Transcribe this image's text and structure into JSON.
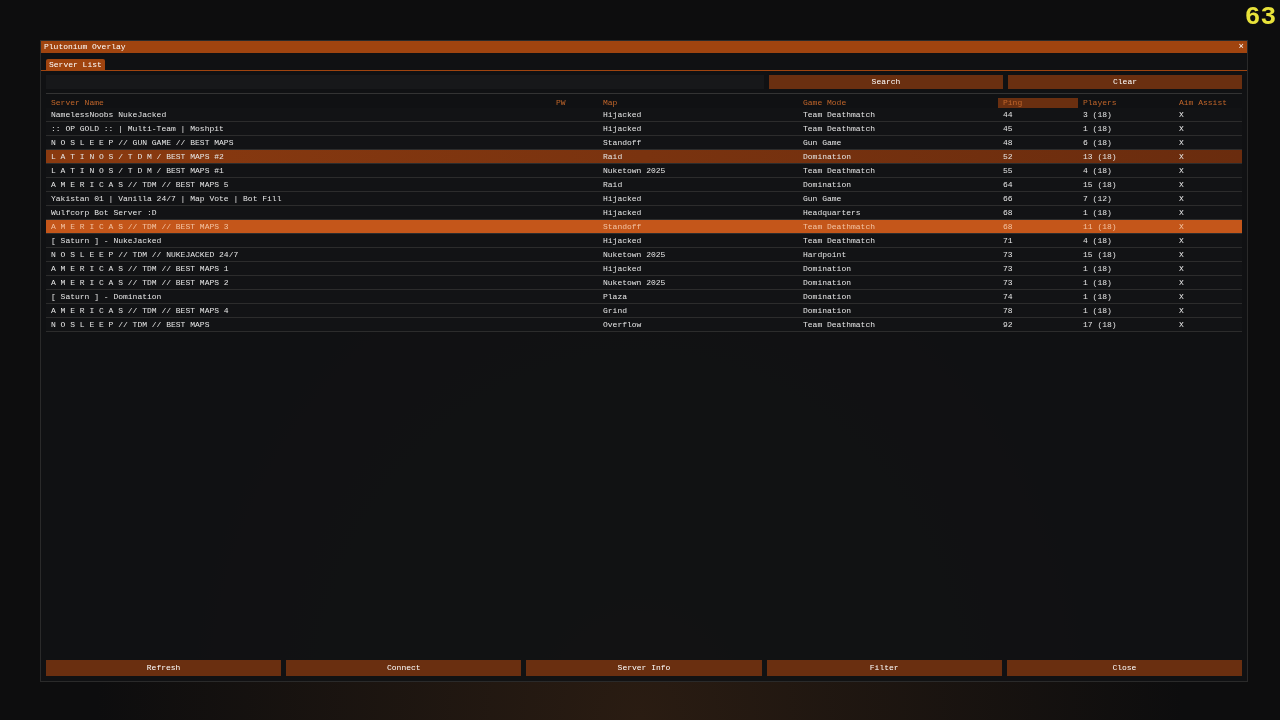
{
  "fps_counter": "63",
  "window": {
    "title": "Plutonium Overlay",
    "close": "×"
  },
  "tabs": [
    {
      "label": "Server List",
      "selected": true
    }
  ],
  "search": {
    "buttons": [
      "Search",
      "Clear"
    ]
  },
  "table": {
    "columns": [
      {
        "label": "Server Name",
        "sorted": false
      },
      {
        "label": "PW",
        "sorted": false
      },
      {
        "label": "Map",
        "sorted": false
      },
      {
        "label": "Game Mode",
        "sorted": false
      },
      {
        "label": "Ping",
        "sorted": true
      },
      {
        "label": "Players",
        "sorted": false
      },
      {
        "label": "Aim Assist",
        "sorted": false
      }
    ],
    "rows": [
      {
        "cells": [
          "NamelessNoobs NukeJacked",
          "",
          "Hijacked",
          "Team Deathmatch",
          "44",
          "3 (18)",
          "X"
        ],
        "selected": false,
        "hovered": false
      },
      {
        "cells": [
          ":: OP GOLD :: | Multi-Team | Moshpit",
          "",
          "Hijacked",
          "Team Deathmatch",
          "45",
          "1 (18)",
          "X"
        ],
        "selected": false,
        "hovered": false
      },
      {
        "cells": [
          "N O S L E E P // GUN GAME // BEST MAPS",
          "",
          "Standoff",
          "Gun Game",
          "48",
          "6 (18)",
          "X"
        ],
        "selected": false,
        "hovered": false
      },
      {
        "cells": [
          "L A T I N O S / T D M / BEST MAPS #2",
          "",
          "Raid",
          "Domination",
          "52",
          "13 (18)",
          "X"
        ],
        "selected": false,
        "hovered": true
      },
      {
        "cells": [
          "L A T I N O S / T D M / BEST MAPS #1",
          "",
          "Nuketown 2025",
          "Team Deathmatch",
          "55",
          "4 (18)",
          "X"
        ],
        "selected": false,
        "hovered": false
      },
      {
        "cells": [
          "A M E R I C A S // TDM // BEST MAPS 5",
          "",
          "Raid",
          "Domination",
          "64",
          "15 (18)",
          "X"
        ],
        "selected": false,
        "hovered": false
      },
      {
        "cells": [
          "Yakistan 01 | Vanilla 24/7 | Map Vote | Bot Fill",
          "",
          "Hijacked",
          "Gun Game",
          "66",
          "7 (12)",
          "X"
        ],
        "selected": false,
        "hovered": false
      },
      {
        "cells": [
          "Wulfcorp Bot Server :D",
          "",
          "Hijacked",
          "Headquarters",
          "68",
          "1 (18)",
          "X"
        ],
        "selected": false,
        "hovered": false
      },
      {
        "cells": [
          "A M E R I C A S // TDM // BEST MAPS 3",
          "",
          "Standoff",
          "Team Deathmatch",
          "68",
          "11 (18)",
          "X"
        ],
        "selected": true,
        "hovered": false
      },
      {
        "cells": [
          "[ Saturn ] - NukeJacked",
          "",
          "Hijacked",
          "Team Deathmatch",
          "71",
          "4 (18)",
          "X"
        ],
        "selected": false,
        "hovered": false
      },
      {
        "cells": [
          "N O S L E E P // TDM // NUKEJACKED 24/7",
          "",
          "Nuketown 2025",
          "Hardpoint",
          "73",
          "15 (18)",
          "X"
        ],
        "selected": false,
        "hovered": false
      },
      {
        "cells": [
          "A M E R I C A S // TDM // BEST MAPS 1",
          "",
          "Hijacked",
          "Domination",
          "73",
          "1 (18)",
          "X"
        ],
        "selected": false,
        "hovered": false
      },
      {
        "cells": [
          "A M E R I C A S // TDM // BEST MAPS 2",
          "",
          "Nuketown 2025",
          "Domination",
          "73",
          "1 (18)",
          "X"
        ],
        "selected": false,
        "hovered": false
      },
      {
        "cells": [
          "[ Saturn ] - Domination",
          "",
          "Plaza",
          "Domination",
          "74",
          "1 (18)",
          "X"
        ],
        "selected": false,
        "hovered": false
      },
      {
        "cells": [
          "A M E R I C A S // TDM // BEST MAPS 4",
          "",
          "Grind",
          "Domination",
          "78",
          "1 (18)",
          "X"
        ],
        "selected": false,
        "hovered": false
      },
      {
        "cells": [
          "N O S L E E P // TDM // BEST MAPS",
          "",
          "Overflow",
          "Team Deathmatch",
          "92",
          "17 (18)",
          "X"
        ],
        "selected": false,
        "hovered": false
      }
    ]
  },
  "footer_buttons": [
    "Refresh",
    "Connect",
    "Server Info",
    "Filter",
    "Close"
  ]
}
